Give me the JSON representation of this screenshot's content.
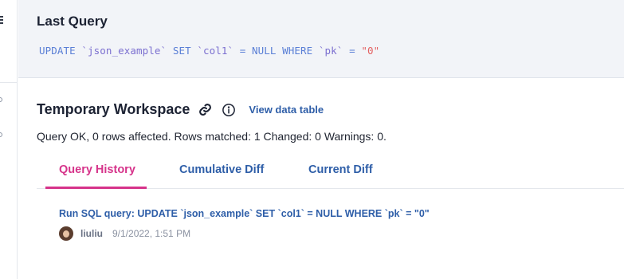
{
  "last_query": {
    "title": "Last Query",
    "code": {
      "kw_update": "UPDATE",
      "table": "`json_example`",
      "kw_set": "SET",
      "column": "`col1`",
      "assign": "= NULL WHERE",
      "pk": "`pk`",
      "eq": "=",
      "value": "\"0\""
    }
  },
  "workspace": {
    "title": "Temporary Workspace",
    "view_link": "View data table",
    "status": "Query OK, 0 rows affected. Rows matched: 1 Changed: 0 Warnings: 0.",
    "tabs": [
      {
        "label": "Query History",
        "active": true
      },
      {
        "label": "Cumulative Diff",
        "active": false
      },
      {
        "label": "Current Diff",
        "active": false
      }
    ],
    "history": [
      {
        "title": "Run SQL query: UPDATE `json_example` SET `col1` = NULL WHERE `pk` = \"0\"",
        "author": "liuliu",
        "date": "9/1/2022, 1:51 PM"
      }
    ]
  },
  "icons": {
    "link": "link-icon",
    "info": "info-icon",
    "menu": "menu-icon"
  },
  "colors": {
    "accent_pink": "#d6338a",
    "link_blue": "#2e5ea8",
    "panel_bg": "#f2f4f8",
    "string_red": "#e36161"
  }
}
